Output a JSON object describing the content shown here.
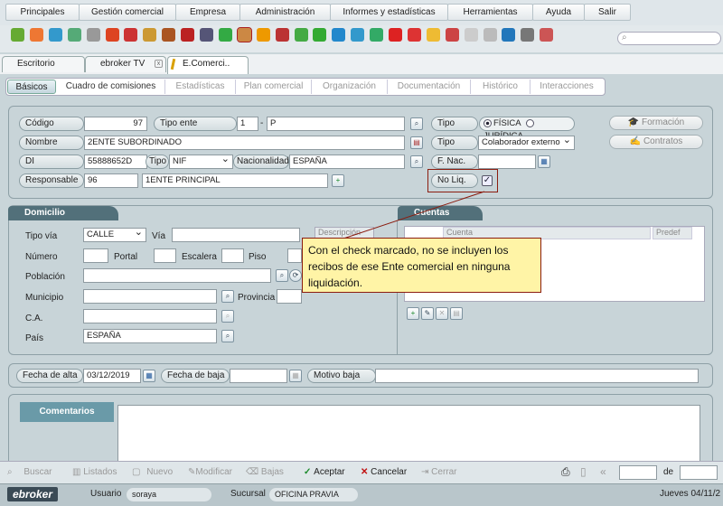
{
  "menu": [
    "Principales",
    "Gestión comercial",
    "Empresa",
    "Administración",
    "Informes y estadísticas",
    "Herramientas",
    "Ayuda",
    "Salir"
  ],
  "toolbar_icons": [
    "cube-icon",
    "user-orange-icon",
    "user-blue-icon",
    "monitor-icon",
    "card-icon",
    "flame-icon",
    "target-icon",
    "pencil-icon",
    "briefcase-icon",
    "bag-icon",
    "house-icon",
    "battery-icon",
    "person-card-icon",
    "people-icon",
    "truck-icon",
    "dial-icon",
    "checkmark-icon",
    "e-icon",
    "diamond-icon",
    "refresh-icon",
    "calendar-icon",
    "g-icon",
    "bulb-icon",
    "inbox-icon",
    "notepad-icon",
    "document-icon",
    "phone-icon",
    "tools-icon",
    "help-icon"
  ],
  "window_tabs": [
    {
      "label": "Escritorio"
    },
    {
      "label": "ebroker TV"
    },
    {
      "label": "E.Comerci.."
    }
  ],
  "sub_tabs": [
    "Básicos",
    "Cuadro de comisiones",
    "Estadísticas",
    "Plan comercial",
    "Organización",
    "Documentación",
    "Histórico",
    "Interacciones"
  ],
  "form": {
    "codigo_label": "Código",
    "codigo": "97",
    "tipo_ente_label": "Tipo ente",
    "tipo_ente_code": "1",
    "tipo_ente_desc": "P",
    "tipo_label": "Tipo",
    "tipo_fisica": "FÍSICA",
    "tipo_juridica": "JURÍDICA",
    "formacion": "Formación",
    "contratos": "Contratos",
    "nombre_label": "Nombre",
    "nombre": "2ENTE SUBORDINADO",
    "tipo2_label": "Tipo",
    "tipo2": "Colaborador externo",
    "di_label": "DI",
    "di": "55888652D",
    "di_tipo_label": "Tipo",
    "di_tipo": "NIF",
    "nacionalidad_label": "Nacionalidad",
    "nacionalidad": "ESPAÑA",
    "fnac_label": "F. Nac.",
    "fnac": "",
    "responsable_label": "Responsable",
    "responsable_code": "96",
    "responsable_name": "1ENTE PRINCIPAL",
    "noliq_label": "No Liq."
  },
  "domicilio": {
    "title": "Domicilio",
    "tipo_via_label": "Tipo vía",
    "tipo_via": "CALLE",
    "via_label": "Vía",
    "numero_label": "Número",
    "portal_label": "Portal",
    "escalera_label": "Escalera",
    "piso_label": "Piso",
    "poblacion_label": "Población",
    "municipio_label": "Municipio",
    "provincia_label": "Provincia",
    "ca_label": "C.A.",
    "pais_label": "País",
    "pais": "ESPAÑA",
    "descripcion_header": "Descripción"
  },
  "cuentas": {
    "title": "Cuentas",
    "cuenta_header": "Cuenta",
    "predet_header": "Predef"
  },
  "tooltip": "Con el check marcado, no se incluyen los recibos de ese Ente comercial en ninguna liquidación.",
  "fechas": {
    "alta_label": "Fecha de alta",
    "alta": "03/12/2019",
    "baja_label": "Fecha de baja",
    "motivo_label": "Motivo baja"
  },
  "comentarios": {
    "title": "Comentarios"
  },
  "bottom": {
    "buscar": "Buscar",
    "listados": "Listados",
    "nuevo": "Nuevo",
    "modificar": "Modificar",
    "bajas": "Bajas",
    "aceptar": "Aceptar",
    "cancelar": "Cancelar",
    "cerrar": "Cerrar",
    "de": "de"
  },
  "status": {
    "brand": "ebroker",
    "usuario_label": "Usuario",
    "usuario": "soraya",
    "sucursal_label": "Sucursal",
    "sucursal": "OFICINA PRAVIA",
    "date": "Jueves 04/11/2"
  },
  "colors": {
    "section": "#52707a",
    "tooltip_bg": "#fff4a6",
    "tooltip_border": "#8b1d10",
    "accept": "#1a8a2a",
    "cancel": "#c01010"
  }
}
